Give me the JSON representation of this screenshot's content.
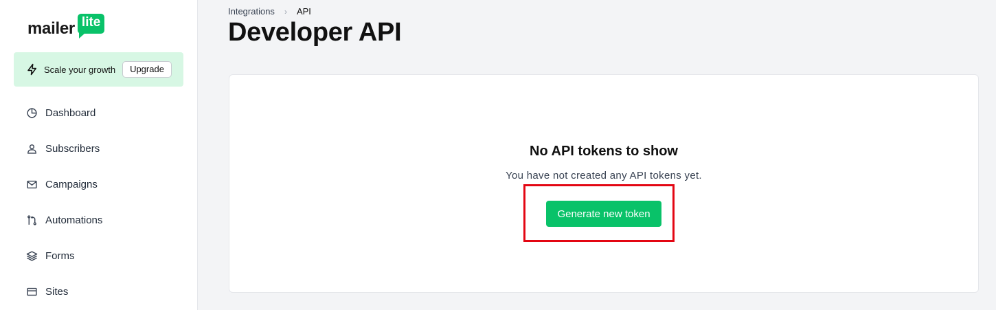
{
  "logo": {
    "word": "mailer",
    "badge": "lite"
  },
  "promo": {
    "text": "Scale your growth",
    "button": "Upgrade",
    "icon": "lightning-icon"
  },
  "nav": {
    "items": [
      {
        "label": "Dashboard",
        "icon": "dashboard-icon"
      },
      {
        "label": "Subscribers",
        "icon": "user-icon"
      },
      {
        "label": "Campaigns",
        "icon": "mail-icon"
      },
      {
        "label": "Automations",
        "icon": "workflow-icon"
      },
      {
        "label": "Forms",
        "icon": "layers-icon"
      },
      {
        "label": "Sites",
        "icon": "sites-icon"
      }
    ]
  },
  "breadcrumb": {
    "parent": "Integrations",
    "current": "API"
  },
  "page": {
    "title": "Developer API"
  },
  "empty_state": {
    "title": "No API tokens to show",
    "description": "You have not created any API tokens yet.",
    "button": "Generate new token"
  },
  "colors": {
    "brand_green": "#09c269",
    "promo_bg": "#d7f7e4",
    "highlight": "#e30613"
  }
}
